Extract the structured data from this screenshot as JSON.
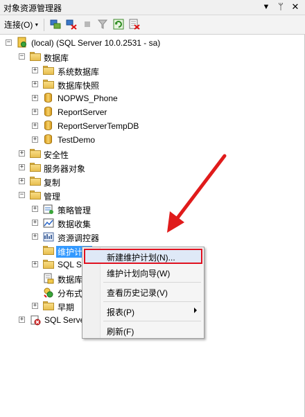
{
  "window": {
    "title": "对象资源管理器"
  },
  "title_icons": [
    "dropdown-arrow-icon",
    "pin-icon",
    "close-icon"
  ],
  "toolbar": {
    "connect_label": "连接(O)",
    "icons": [
      "connect-icon",
      "disconnect-icon",
      "stop-icon",
      "filter-icon",
      "refresh-icon",
      "sync-icon"
    ]
  },
  "tree": {
    "server": {
      "label": "(local) (SQL Server 10.0.2531 - sa)"
    },
    "databases": {
      "label": "数据库",
      "children": [
        "系统数据库",
        "数据库快照",
        "NOPWS_Phone",
        "ReportServer",
        "ReportServerTempDB",
        "TestDemo"
      ]
    },
    "security": {
      "label": "安全性"
    },
    "server_objects": {
      "label": "服务器对象"
    },
    "replication": {
      "label": "复制"
    },
    "management": {
      "label": "管理",
      "children": [
        "策略管理",
        "数据收集",
        "资源调控器",
        "维护计划",
        "SQL S",
        "数据库",
        "分布式",
        "早期"
      ]
    },
    "sql_agent": {
      "label": "SQL Serve"
    }
  },
  "context_menu": {
    "items": [
      "新建维护计划(N)...",
      "维护计划向导(W)",
      "查看历史记录(V)",
      "报表(P)",
      "刷新(F)"
    ]
  },
  "colors": {
    "highlight_border": "#e0101e",
    "selection": "#3399ff",
    "annotation_arrow": "#e01b1b"
  }
}
